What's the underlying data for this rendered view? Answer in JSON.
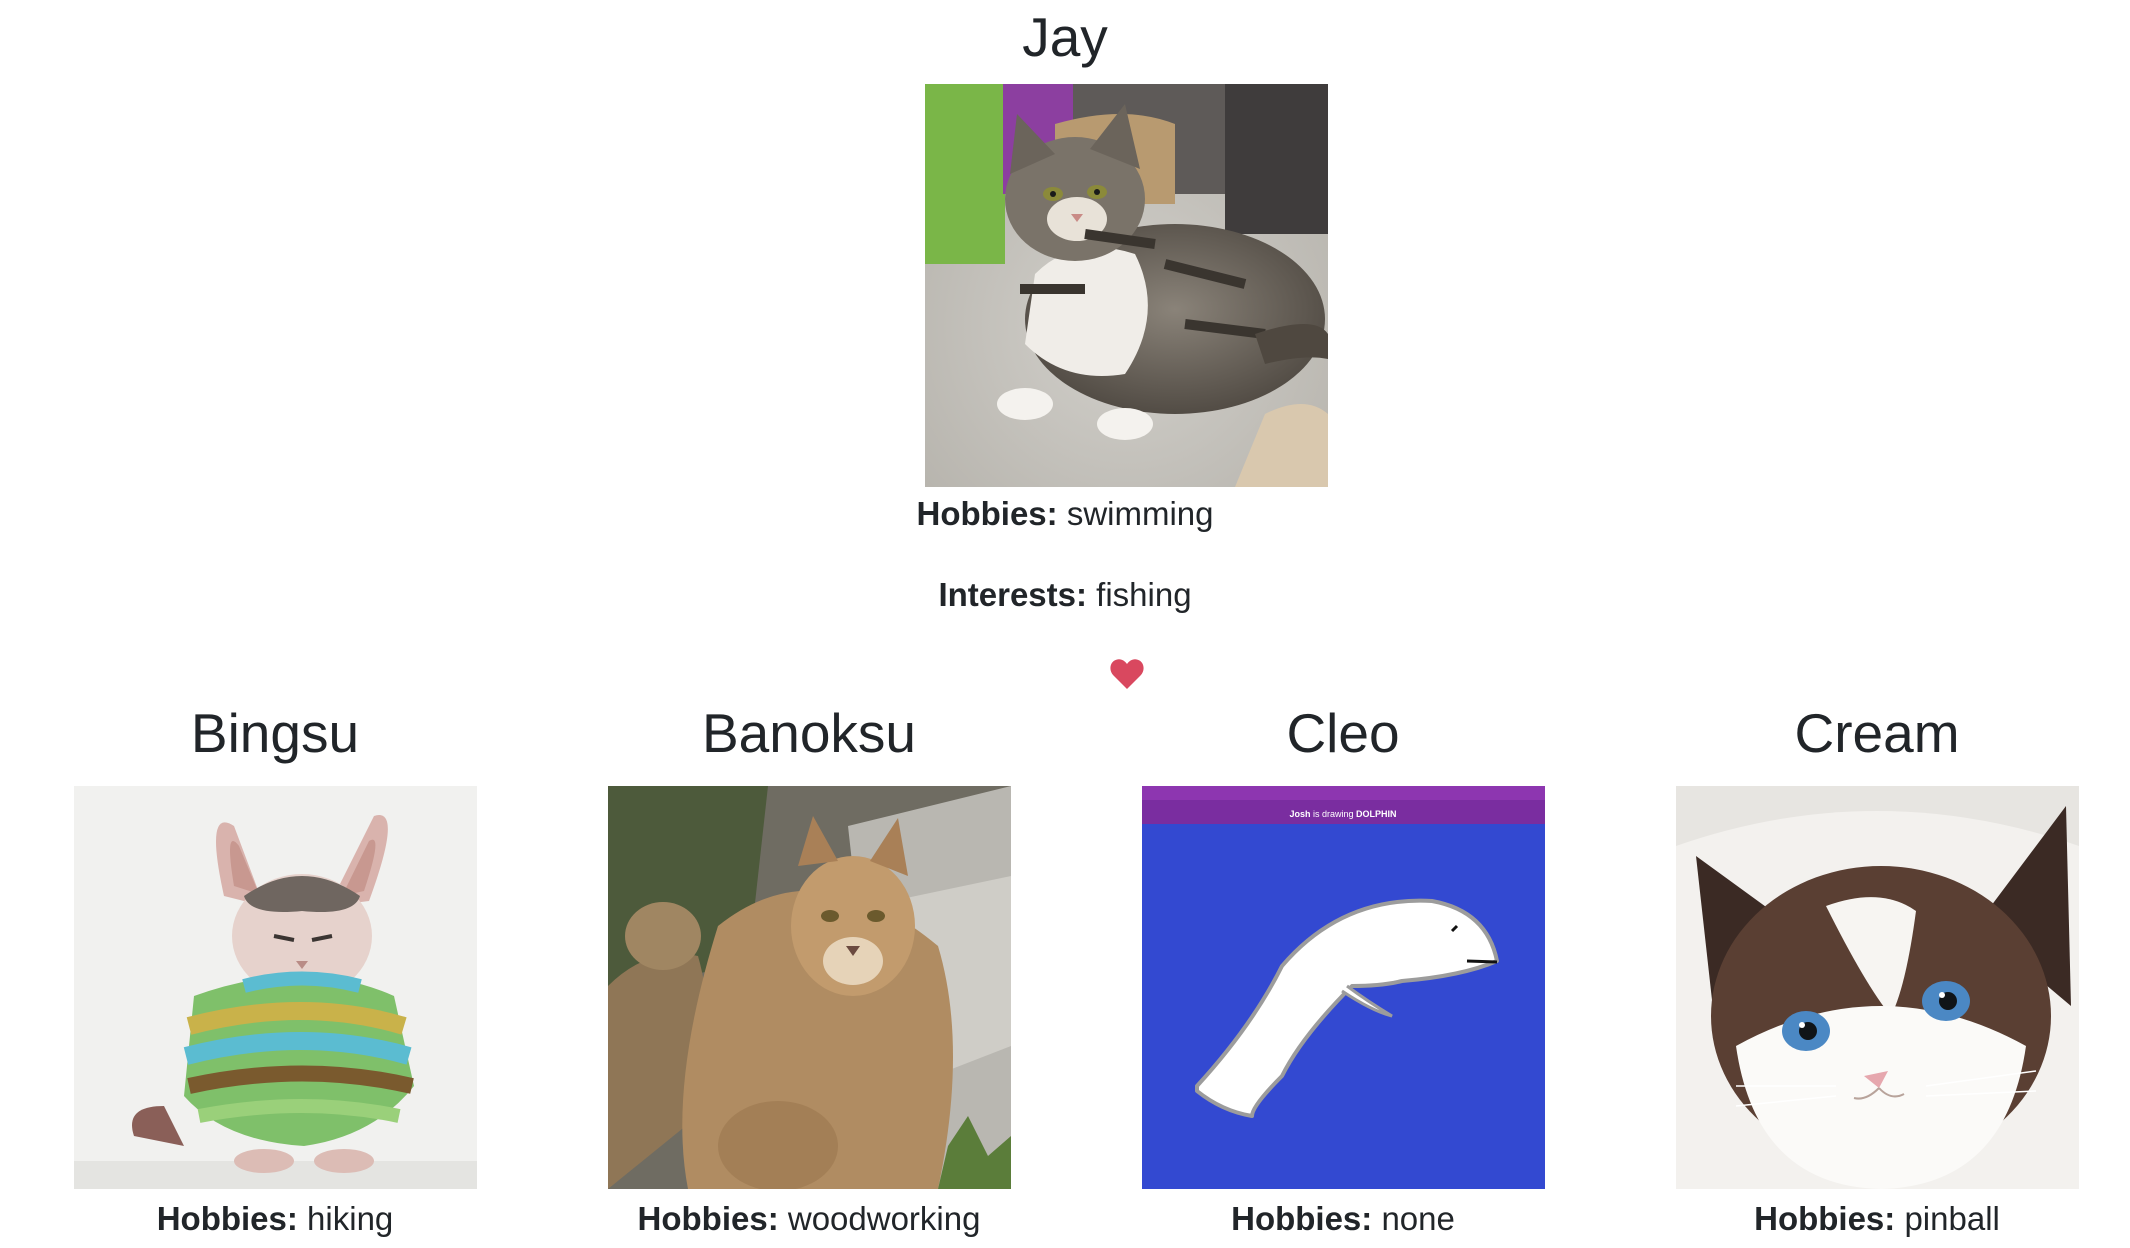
{
  "featured": {
    "name": "Jay",
    "photo_alt": "tabby cat lying on carpet",
    "hobbies_label": "Hobbies:",
    "hobbies_value": "swimming",
    "interests_label": "Interests:",
    "interests_value": "fishing"
  },
  "heart_icon": "heart-icon",
  "colors": {
    "heart": "#d9485f",
    "text": "#212529"
  },
  "matches": [
    {
      "name": "Bingsu",
      "photo_alt": "sphynx cat in striped sweater",
      "hobbies_label": "Hobbies:",
      "hobbies_value": "hiking"
    },
    {
      "name": "Banoksu",
      "photo_alt": "cougar sitting by rocks",
      "hobbies_label": "Hobbies:",
      "hobbies_value": "woodworking"
    },
    {
      "name": "Cleo",
      "photo_alt": "drawing of a white dolphin on blue background",
      "photo_caption_prefix": "Josh",
      "photo_caption_middle": " is drawing ",
      "photo_caption_word": "DOLPHIN",
      "hobbies_label": "Hobbies:",
      "hobbies_value": "none"
    },
    {
      "name": "Cream",
      "photo_alt": "ragdoll cat with blue eyes",
      "hobbies_label": "Hobbies:",
      "hobbies_value": "pinball"
    }
  ]
}
